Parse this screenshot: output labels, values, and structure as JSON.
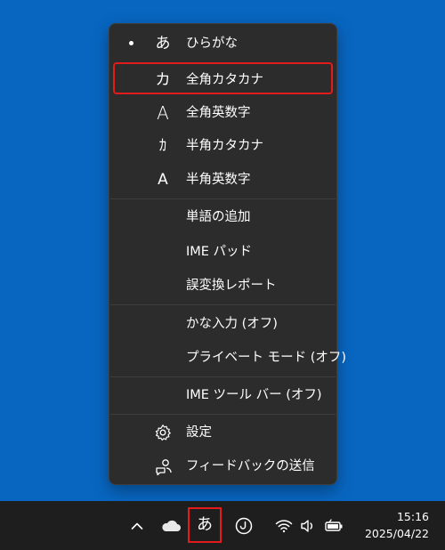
{
  "menu": {
    "items": [
      {
        "glyph": "あ",
        "label": "ひらがな",
        "checked": true
      },
      {
        "glyph": "カ",
        "label": "全角カタカナ",
        "selected": true
      },
      {
        "glyph": "A",
        "label": "全角英数字"
      },
      {
        "glyph": "ｶ",
        "label": "半角カタカナ"
      },
      {
        "glyph": "A",
        "label": "半角英数字"
      },
      {
        "label": "単語の追加"
      },
      {
        "label": "IME パッド"
      },
      {
        "label": "誤変換レポート"
      },
      {
        "label": "かな入力 (オフ)"
      },
      {
        "label": "プライベート モード (オフ)"
      },
      {
        "label": "IME ツール バー (オフ)"
      },
      {
        "icon": "gear-icon",
        "label": "設定"
      },
      {
        "icon": "feedback-icon",
        "label": "フィードバックの送信"
      }
    ]
  },
  "taskbar": {
    "ime_indicator": "あ",
    "icons": [
      "chevron-up-icon",
      "cloud-icon",
      "ime-mode-icon",
      "wifi-icon",
      "volume-icon",
      "battery-icon"
    ],
    "time": "15:16",
    "date": "2025/04/22"
  },
  "colors": {
    "desktop": "#0866c1",
    "menu_bg": "#2c2c2c",
    "taskbar_bg": "#1e1e1e",
    "highlight": "#e21c1c"
  }
}
